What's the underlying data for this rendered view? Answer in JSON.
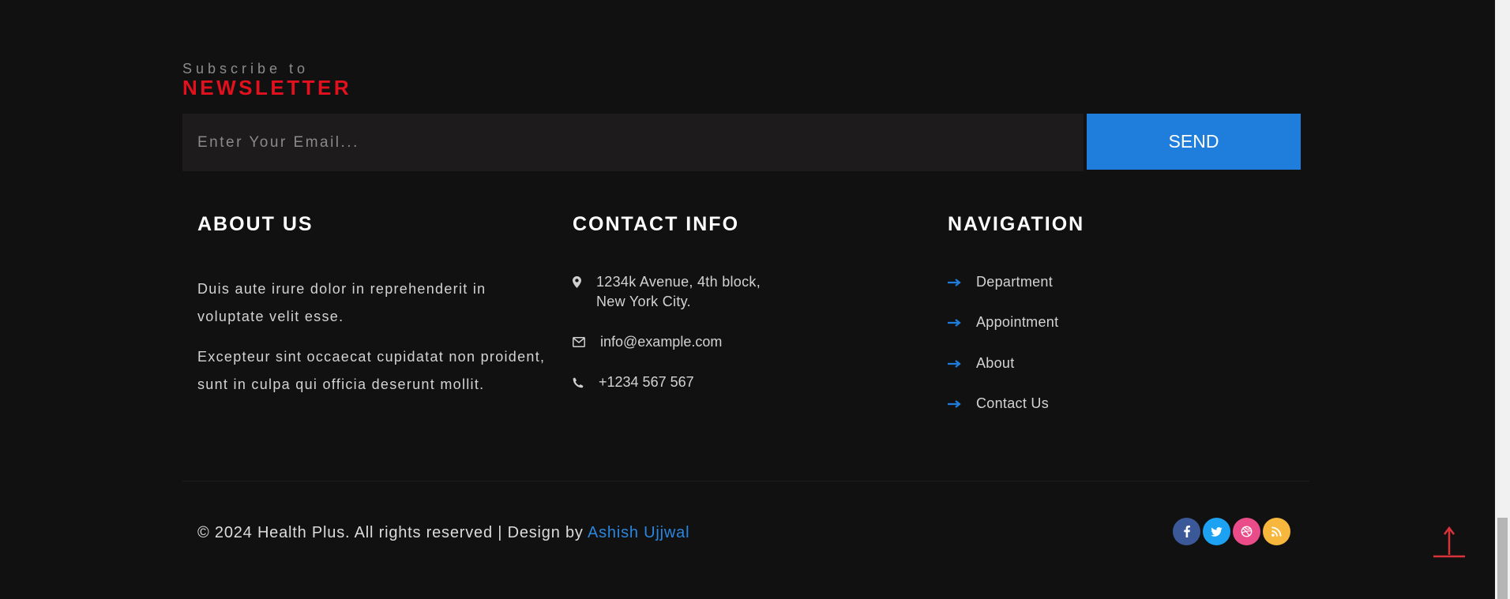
{
  "newsletter": {
    "subtitle": "Subscribe to",
    "title": "NEWSLETTER",
    "email_placeholder": "Enter Your Email...",
    "send_label": "SEND"
  },
  "about": {
    "title": "ABOUT US",
    "paragraphs": [
      "Duis aute irure dolor in reprehenderit in voluptate velit esse.",
      "Excepteur sint occaecat cupidatat non proident, sunt in culpa qui officia deserunt mollit."
    ]
  },
  "contact": {
    "title": "CONTACT INFO",
    "address_line1": "1234k Avenue, 4th block,",
    "address_line2": "New York City.",
    "email": "info@example.com",
    "phone": "+1234 567 567",
    "icons": [
      "map-marker-icon",
      "envelope-icon",
      "phone-icon"
    ]
  },
  "navigation": {
    "title": "NAVIGATION",
    "items": [
      {
        "label": "Department"
      },
      {
        "label": "Appointment"
      },
      {
        "label": "About"
      },
      {
        "label": "Contact Us"
      }
    ]
  },
  "footer": {
    "copyright": "© 2024 Health Plus. All rights reserved | Design by ",
    "designer": "Ashish Ujjwal",
    "socials": [
      "facebook-icon",
      "twitter-icon",
      "dribbble-icon",
      "rss-icon"
    ]
  },
  "colors": {
    "background": "#111111",
    "accent_blue": "#1f7ddb",
    "accent_red": "#e3101d",
    "facebook": "#3b5998",
    "twitter": "#1da1f2",
    "dribbble": "#ea4c89",
    "rss": "#f6b73c"
  }
}
